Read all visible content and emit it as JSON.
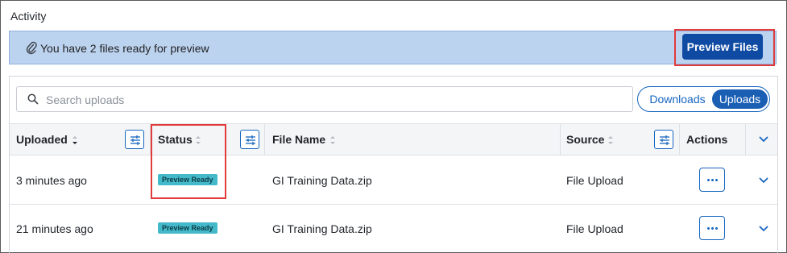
{
  "activity": {
    "title": "Activity"
  },
  "banner": {
    "message": "You have 2 files ready for preview",
    "button_label": "Preview Files"
  },
  "search": {
    "placeholder": "Search uploads",
    "value": ""
  },
  "toggle": {
    "downloads": "Downloads",
    "uploads": "Uploads",
    "selected": "Uploads"
  },
  "table": {
    "columns": {
      "uploaded": "Uploaded",
      "status": "Status",
      "file_name": "File Name",
      "source": "Source",
      "actions": "Actions"
    },
    "rows": [
      {
        "uploaded": "3 minutes ago",
        "status": "Preview Ready",
        "file_name": "GI Training Data.zip",
        "source": "File Upload"
      },
      {
        "uploaded": "21 minutes ago",
        "status": "Preview Ready",
        "file_name": "GI Training Data.zip",
        "source": "File Upload"
      }
    ]
  },
  "colors": {
    "primary": "#0f4ba3",
    "banner_bg": "#bcd3f0",
    "badge_bg": "#43b9c9",
    "highlight": "#e23b3b"
  },
  "icons": [
    "paperclip-icon",
    "search-icon",
    "sort-icon",
    "filter-icon",
    "chevron-down-icon",
    "more-icon"
  ]
}
